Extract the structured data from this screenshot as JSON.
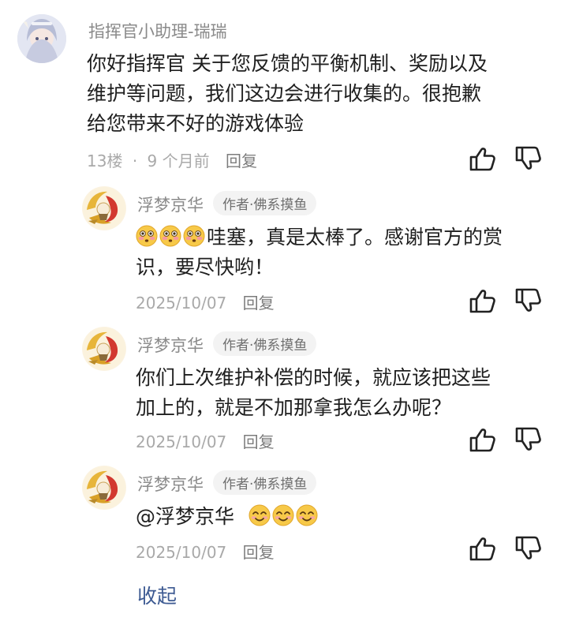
{
  "main_comment": {
    "username": "指挥官小助理-瑞瑞",
    "lines": [
      "你好指挥官 关于您反馈的平衡机制、奖励以及",
      "维护等问题，我们这边会进行收集的。很抱歉",
      "给您带来不好的游戏体验"
    ],
    "floor": "13楼",
    "separator": "·",
    "time": "9 个月前",
    "reply_label": "回复"
  },
  "replies": [
    {
      "username": "浮梦京华",
      "tag": "作者·佛系摸鱼",
      "lines": [
        "哇塞，真是太棒了。感谢官方的赏",
        "识，要尽快哟！"
      ],
      "emojis": [
        "flushed-face",
        "flushed-face",
        "flushed-face"
      ],
      "date": "2025/10/07",
      "reply_label": "回复"
    },
    {
      "username": "浮梦京华",
      "tag": "作者·佛系摸鱼",
      "lines": [
        "你们上次维护补偿的时候，就应该把这些",
        "加上的，就是不加那拿我怎么办呢？"
      ],
      "date": "2025/10/07",
      "reply_label": "回复"
    },
    {
      "username": "浮梦京华",
      "tag": "作者·佛系摸鱼",
      "mention": "@浮梦京华",
      "emojis": [
        "smiling-face",
        "smiling-face",
        "smiling-face"
      ],
      "date": "2025/10/07",
      "reply_label": "回复"
    }
  ],
  "collapse_label": "收起",
  "colors": {
    "link": "#3d5a92",
    "muted": "#a9a9a9",
    "emoji": "#f7c948"
  }
}
